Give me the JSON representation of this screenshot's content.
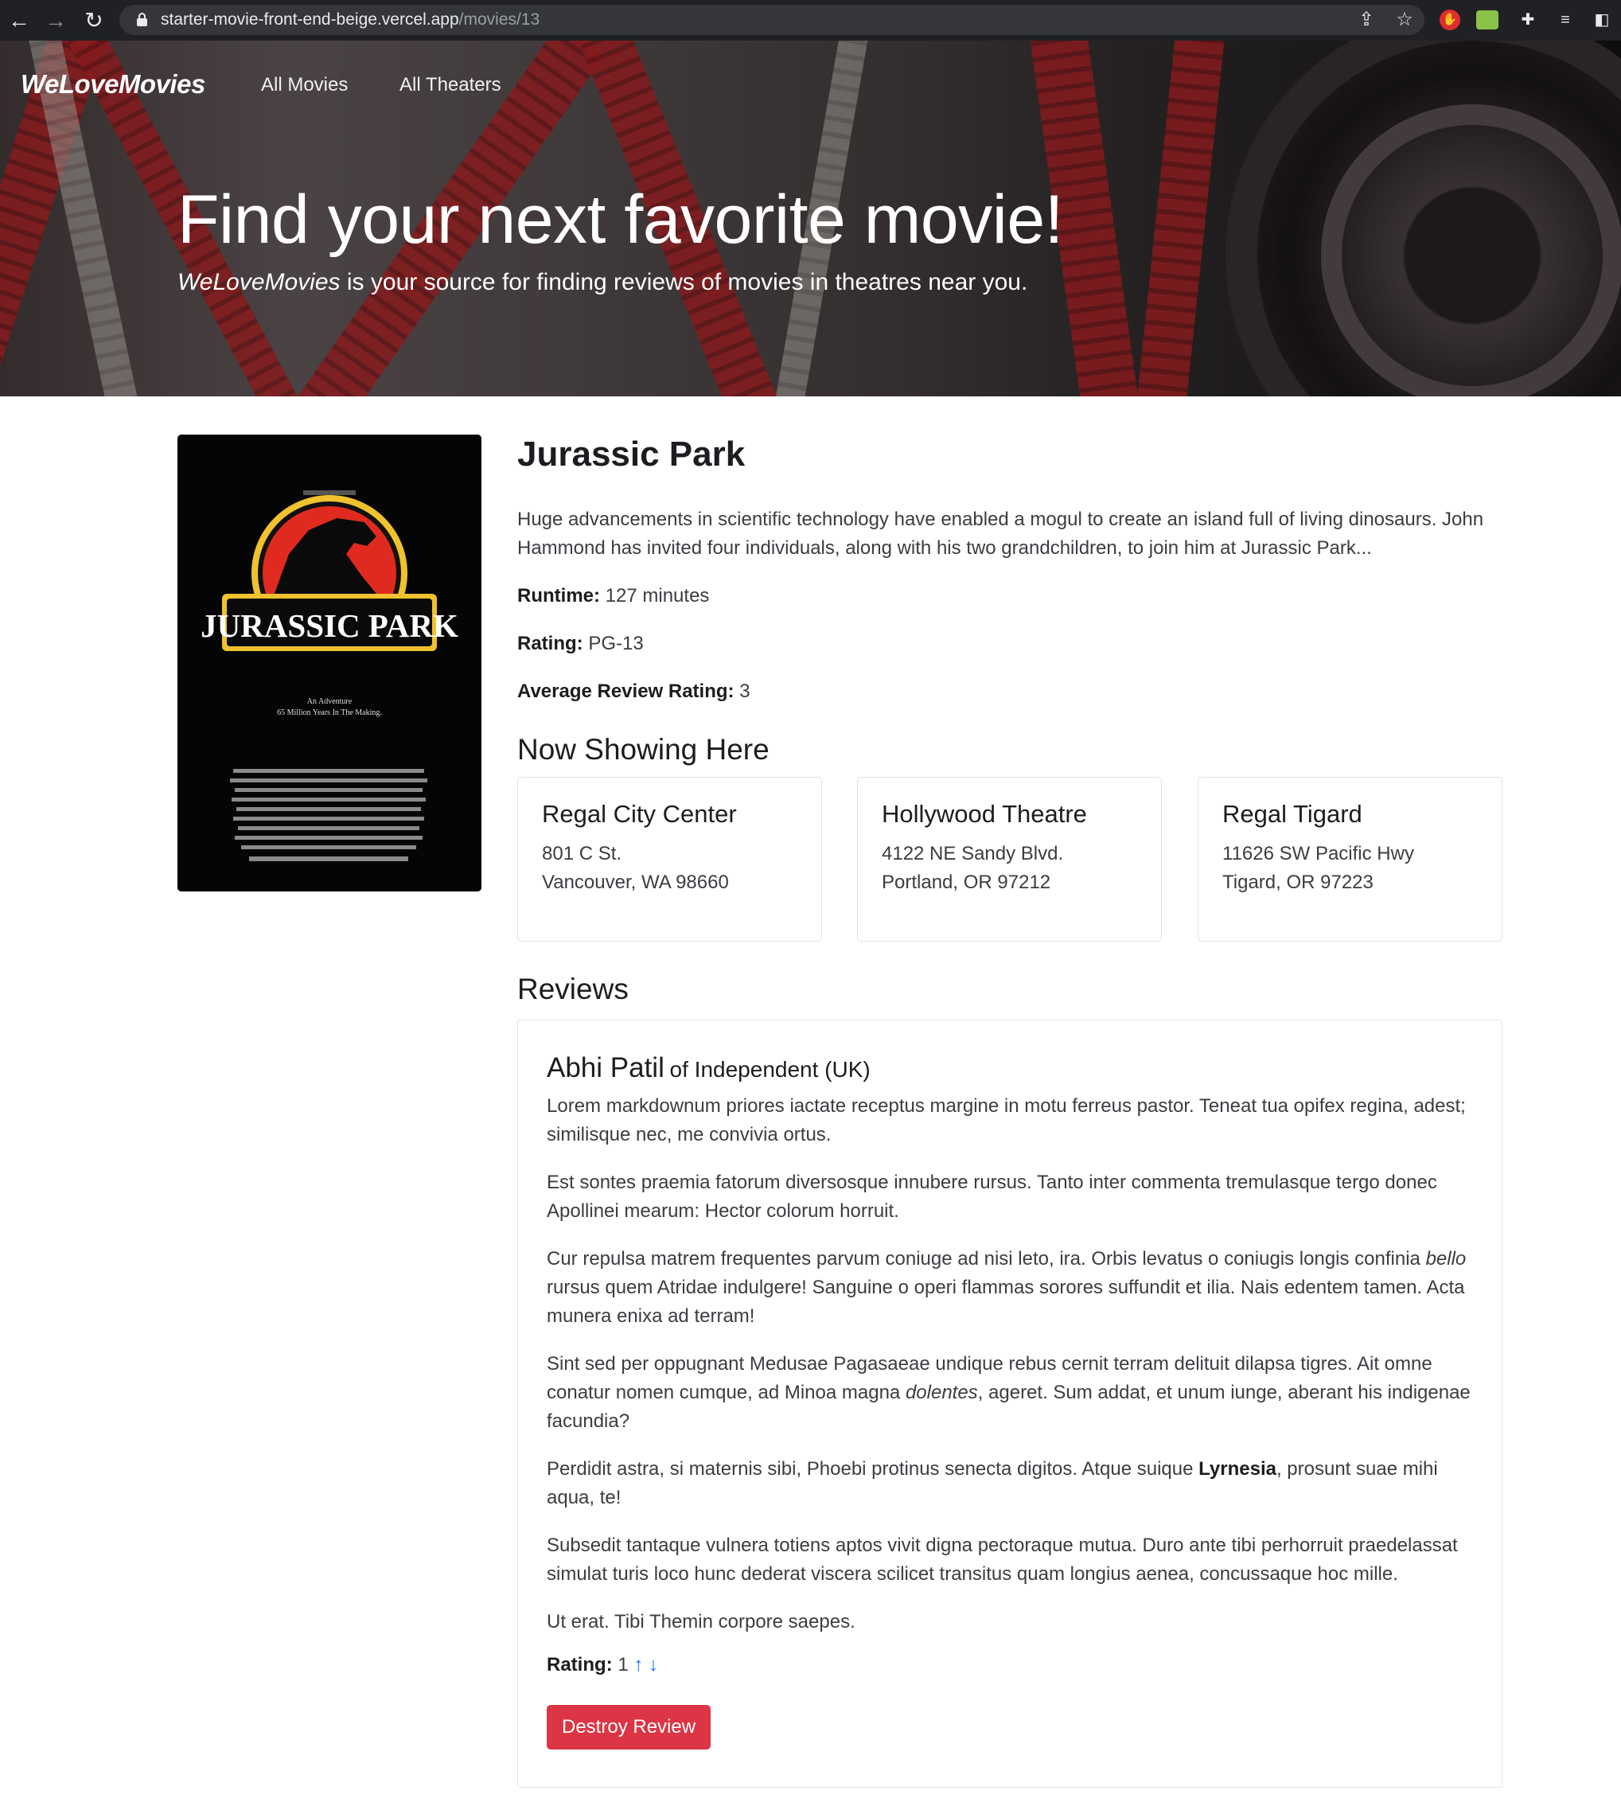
{
  "browser": {
    "url_domain": "starter-movie-front-end-beige.vercel.app",
    "url_path": "/movies/13"
  },
  "nav": {
    "brand": "WeLoveMovies",
    "links": [
      "All Movies",
      "All Theaters"
    ]
  },
  "hero": {
    "title": "Find your next favorite movie!",
    "subtitle_brand": "WeLoveMovies",
    "subtitle_rest": " is your source for finding reviews of movies in theatres near you."
  },
  "poster": {
    "logo_text": "JURASSIC PARK",
    "tagline_1": "An Adventure",
    "tagline_2": "65 Million Years In The Making."
  },
  "movie": {
    "title": "Jurassic Park",
    "description": "Huge advancements in scientific technology have enabled a mogul to create an island full of living dinosaurs. John Hammond has invited four individuals, along with his two grandchildren, to join him at Jurassic Park...",
    "runtime_label": "Runtime:",
    "runtime_value": "127 minutes",
    "rating_label": "Rating:",
    "rating_value": "PG-13",
    "avg_label": "Average Review Rating:",
    "avg_value": "3"
  },
  "now_showing": {
    "heading": "Now Showing Here",
    "theaters": [
      {
        "name": "Regal City Center",
        "address1": "801 C St.",
        "address2": "Vancouver, WA 98660"
      },
      {
        "name": "Hollywood Theatre",
        "address1": "4122 NE Sandy Blvd.",
        "address2": "Portland, OR 97212"
      },
      {
        "name": "Regal Tigard",
        "address1": "11626 SW Pacific Hwy",
        "address2": "Tigard, OR 97223"
      }
    ]
  },
  "reviews": {
    "heading": "Reviews",
    "items": [
      {
        "critic_name": "Abhi Patil",
        "critic_org": "of Independent (UK)",
        "p1": "Lorem markdownum priores iactate receptus margine in motu ferreus pastor. Teneat tua opifex regina, adest; similisque nec, me convivia ortus.",
        "p2": "Est sontes praemia fatorum diversosque innubere rursus. Tanto inter commenta tremulasque tergo donec Apollinei mearum: Hector colorum horruit.",
        "p3a": "Cur repulsa matrem frequentes parvum coniuge ad nisi leto, ira. Orbis levatus o coniugis longis confinia ",
        "p3em": "bello",
        "p3b": " rursus quem Atridae indulgere! Sanguine o operi flammas sorores suffundit et ilia. Nais edentem tamen. Acta munera enixa ad terram!",
        "p4a": "Sint sed per oppugnant Medusae Pagasaeae undique rebus cernit terram delituit dilapsa tigres. Ait omne conatur nomen cumque, ad Minoa magna ",
        "p4em": "dolentes",
        "p4b": ", ageret. Sum addat, et unum iunge, aberant his indigenae facundia?",
        "p5a": "Perdidit astra, si maternis sibi, Phoebi protinus senecta digitos. Atque suique ",
        "p5b": "Lyrnesia",
        "p5c": ", prosunt suae mihi aqua, te!",
        "p6": "Subsedit tantaque vulnera totiens aptos vivit digna pectoraque mutua. Duro ante tibi perhorruit praedelassat simulat turis loco hunc dederat viscera scilicet transitus quam longius aenea, concussaque hoc mille.",
        "p7": "Ut erat. Tibi Themin corpore saepes.",
        "rating_label": "Rating:",
        "rating_value": "1",
        "up_arrow": "↑",
        "down_arrow": "↓",
        "destroy_label": "Destroy Review"
      }
    ]
  },
  "colors": {
    "danger": "#dc3545",
    "link": "#0d6efd",
    "chrome_bg": "#202124"
  }
}
